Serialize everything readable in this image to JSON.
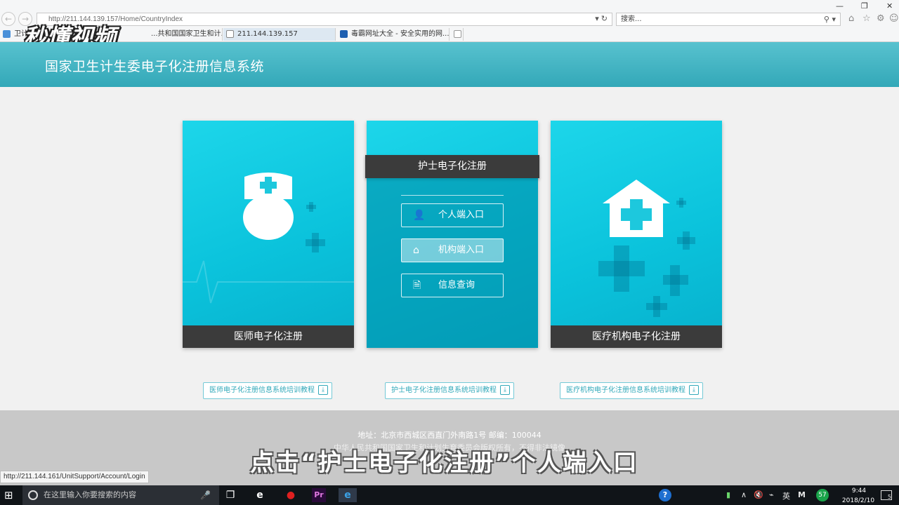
{
  "browser": {
    "url": "http://211.144.139.157/Home/CountryIndex",
    "search_placeholder": "搜索...",
    "tabs": [
      {
        "label": "卫计..."
      },
      {
        "label": "...共和国国家卫生和计..."
      },
      {
        "label": "211.144.139.157"
      },
      {
        "label": "毒霸网址大全 - 安全实用的网..."
      },
      {
        "label": ""
      }
    ],
    "logo_text": "秒懂视频",
    "status_url": "http://211.144.161/UnitSupport/Account/Login"
  },
  "site": {
    "title": "国家卫生计生委电子化注册信息系统"
  },
  "cards": {
    "doctor_label": "医师电子化注册",
    "nurse_label": "护士电子化注册",
    "institution_label": "医疗机构电子化注册"
  },
  "nurse_menu": {
    "personal": "个人端入口",
    "institution": "机构端入口",
    "query": "信息查询"
  },
  "tutorials": {
    "doctor": "医师电子化注册信息系统培训教程",
    "nurse": "护士电子化注册信息系统培训教程",
    "institution": "医疗机构电子化注册信息系统培训教程"
  },
  "footer": {
    "address": "地址：北京市西城区西直门外南路1号 邮编：100044",
    "copyright": "中华人民共和国国家卫生和计划生育委员会版权所有，不得非法镜像"
  },
  "caption": "点击“护士电子化注册”个人端入口",
  "taskbar": {
    "search_placeholder": "在这里输入你要搜索的内容",
    "badge": "57",
    "ime": "英",
    "time": "9:44",
    "date": "2018/2/10",
    "notif_count": "5"
  }
}
